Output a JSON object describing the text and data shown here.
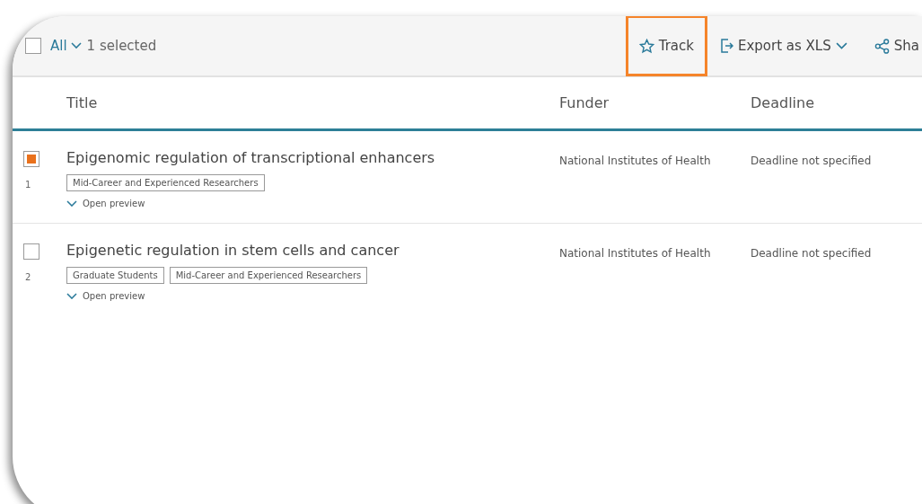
{
  "toolbar": {
    "select_all": {
      "checked": false,
      "label": "All"
    },
    "selection_count": "1 selected",
    "actions": [
      {
        "kind": "star",
        "label": "Track",
        "highlighted": true
      },
      {
        "kind": "export",
        "label": "Export as XLS",
        "highlighted": false
      },
      {
        "kind": "share",
        "label": "Sha",
        "highlighted": false
      }
    ]
  },
  "table": {
    "columns": [
      "Title",
      "Funder",
      "Deadline"
    ],
    "rows": [
      {
        "checked": true,
        "number": "1",
        "title": "Epigenomic regulation of transcriptional enhancers",
        "tags": [
          "Mid-Career and Experienced Researchers"
        ],
        "preview": "Open preview",
        "funder": "National Institutes of Health",
        "deadline": "Deadline not specified"
      },
      {
        "checked": false,
        "number": "2",
        "title": "Epigenetic regulation in stem cells and cancer",
        "tags": [
          "Graduate Students",
          "Mid-Career and Experienced Researchers"
        ],
        "preview": "Open preview",
        "funder": "National Institutes of Health",
        "deadline": "Deadline not specified"
      }
    ]
  }
}
